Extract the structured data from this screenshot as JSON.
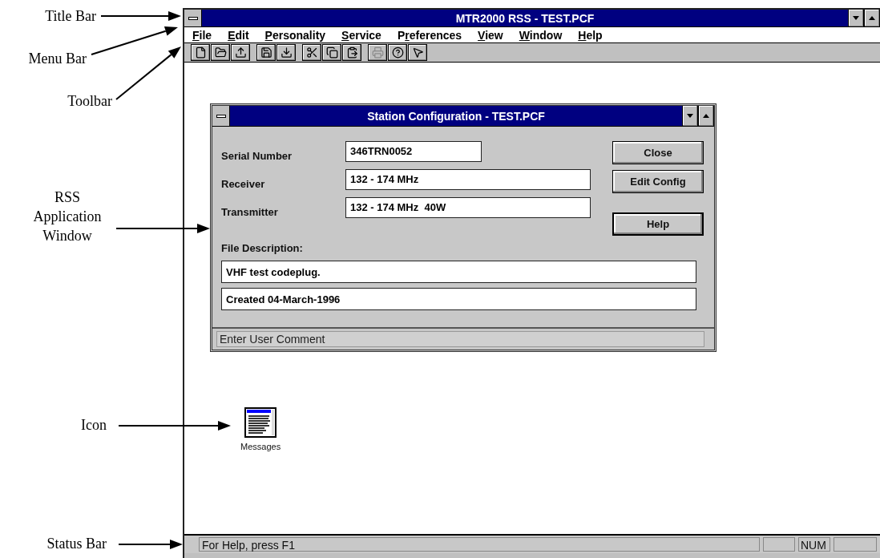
{
  "callouts": [
    {
      "label": "Title Bar"
    },
    {
      "label": "Menu Bar"
    },
    {
      "label": "Toolbar"
    },
    {
      "label": "RSS Application Window"
    },
    {
      "label": "Icon"
    },
    {
      "label": "Status Bar"
    }
  ],
  "window": {
    "title": "MTR2000 RSS - TEST.PCF"
  },
  "menu": [
    {
      "key": "F",
      "after": "ile"
    },
    {
      "key": "E",
      "after": "dit"
    },
    {
      "key": "P",
      "after": "ersonality"
    },
    {
      "key": "S",
      "after": "ervice"
    },
    {
      "before": "P",
      "key": "r",
      "after": "eferences"
    },
    {
      "key": "V",
      "after": "iew"
    },
    {
      "key": "W",
      "after": "indow"
    },
    {
      "key": "H",
      "after": "elp"
    }
  ],
  "toolbar": [
    [
      {
        "kind": "new",
        "disabled": false
      },
      {
        "kind": "open",
        "disabled": false
      },
      {
        "kind": "upload",
        "disabled": false
      }
    ],
    [
      {
        "kind": "save",
        "disabled": false
      },
      {
        "kind": "download",
        "disabled": false
      }
    ],
    [
      {
        "kind": "cut",
        "disabled": false
      },
      {
        "kind": "copy",
        "disabled": false
      },
      {
        "kind": "paste",
        "disabled": false
      }
    ],
    [
      {
        "kind": "print",
        "disabled": true
      },
      {
        "kind": "help",
        "disabled": false
      },
      {
        "kind": "context-help",
        "disabled": false
      }
    ]
  ],
  "dialog": {
    "title": "Station Configuration - TEST.PCF",
    "fields": [
      {
        "label": "Serial Number",
        "value": "346TRN0052",
        "kind": "short"
      },
      {
        "label": "Receiver",
        "value": "132 - 174 MHz",
        "kind": "long"
      },
      {
        "label": "Transmitter",
        "value": "132 - 174 MHz  40W",
        "kind": "long"
      }
    ],
    "buttons": [
      {
        "label": "Close",
        "default": false
      },
      {
        "label": "Edit Config",
        "default": false
      },
      {
        "label": "Help",
        "default": true
      }
    ],
    "description_label": "File Description:",
    "description_lines": [
      "VHF test codeplug.",
      "Created 04-March-1996"
    ],
    "status": "Enter User Comment"
  },
  "desktop_icon": {
    "label": "Messages"
  },
  "status_bar": {
    "message": "For Help, press F1",
    "indicators": [
      "NUM"
    ]
  }
}
